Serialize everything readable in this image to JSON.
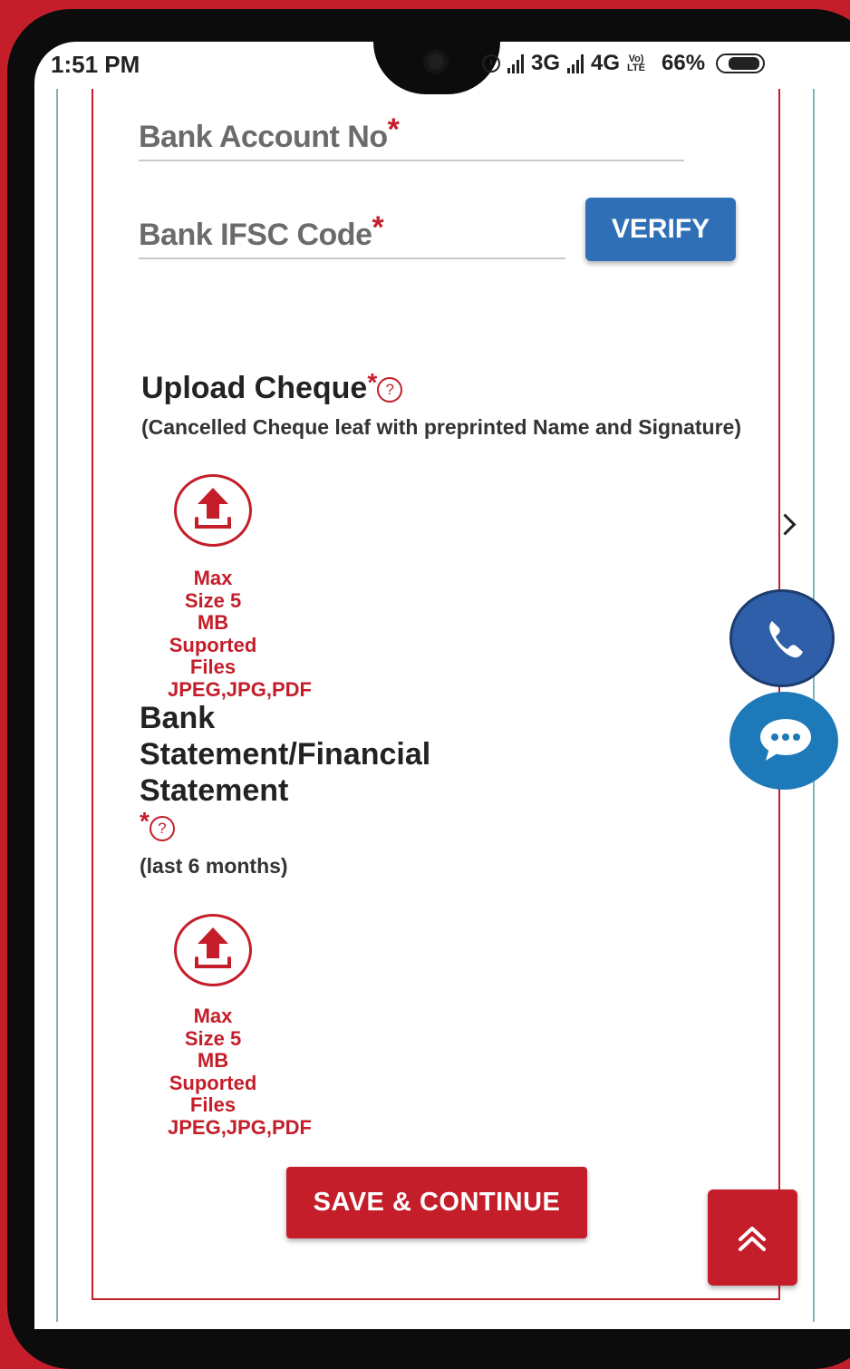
{
  "status_bar": {
    "time": "1:51 PM",
    "network_1": "3G",
    "network_2": "4G",
    "network_2_sub": "LTE",
    "volte": "Vo)",
    "volte_sub": "LTE",
    "battery": "66%",
    "icons": [
      "alarm-icon",
      "signal-icon",
      "signal-icon",
      "battery-icon"
    ]
  },
  "form": {
    "account_label": "Bank Account No",
    "ifsc_label": "Bank IFSC Code",
    "required_mark": "*",
    "verify_label": "VERIFY"
  },
  "cheque": {
    "title": "Upload Cheque",
    "subtitle": "(Cancelled Cheque leaf with preprinted Name and Signature)",
    "upload_info": [
      "Max",
      "Size 5",
      "MB",
      "Suported",
      "Files",
      "JPEG,JPG,PDF"
    ]
  },
  "statement": {
    "title_lines": [
      "Bank",
      "Statement/Financial",
      "Statement"
    ],
    "subtitle": "(last 6 months)",
    "upload_info": [
      "Max",
      "Size 5",
      "MB",
      "Suported",
      "Files",
      "JPEG,JPG,PDF"
    ]
  },
  "help_mark": "?",
  "actions": {
    "save_label": "SAVE & CONTINUE"
  },
  "colors": {
    "brand_red": "#c41e2a",
    "verify_blue": "#2f6fb5",
    "call_blue": "#2f5fa8",
    "chat_blue": "#1e79b9"
  }
}
